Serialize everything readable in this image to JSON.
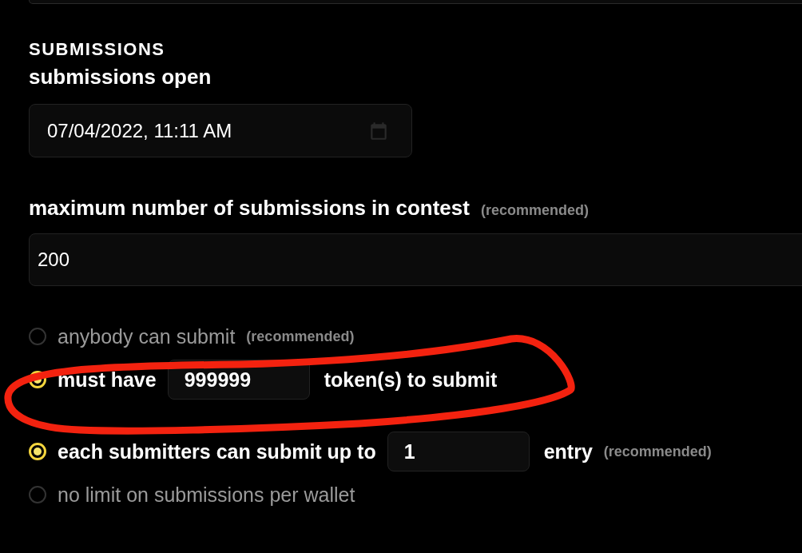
{
  "section_title": "SUBMISSIONS",
  "open_field": {
    "label": "submissions open",
    "value": "07/04/2022, 11:11 AM"
  },
  "max_field": {
    "label": "maximum number of submissions in contest",
    "hint": "(recommended)",
    "value": "200"
  },
  "access_options": [
    {
      "kind": "plain",
      "text": "anybody can submit",
      "hint": "(recommended)",
      "selected": false
    },
    {
      "kind": "input",
      "before": "must have",
      "value": "999999",
      "after": "token(s) to submit",
      "selected": true
    }
  ],
  "limit_options": [
    {
      "kind": "input",
      "before": "each submitters can submit up to",
      "value": "1",
      "after": "entry",
      "hint": "(recommended)",
      "selected": true
    },
    {
      "kind": "plain",
      "text": "no limit on submissions per wallet",
      "selected": false
    }
  ]
}
